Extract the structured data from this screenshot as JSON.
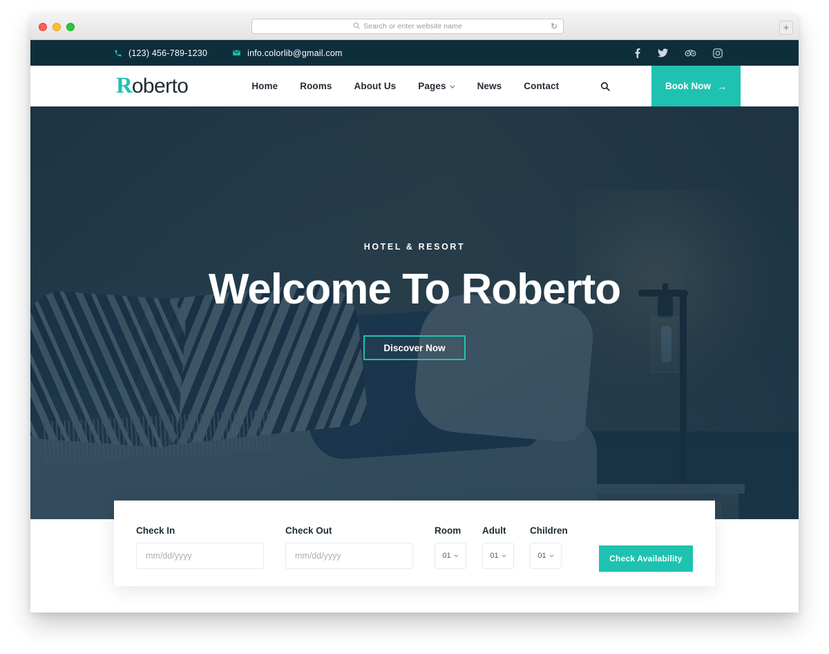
{
  "browser": {
    "address_placeholder": "Search or enter website name",
    "search_icon": "search-icon",
    "reload_icon": "reload-icon",
    "new_tab_label": "+"
  },
  "topbar": {
    "phone": "(123) 456-789-1230",
    "email": "info.colorlib@gmail.com",
    "phone_icon": "phone-icon",
    "email_icon": "envelope-icon",
    "social": [
      {
        "name": "facebook-icon",
        "label": "f"
      },
      {
        "name": "twitter-icon",
        "label": "t"
      },
      {
        "name": "tripadvisor-icon",
        "label": "ta"
      },
      {
        "name": "instagram-icon",
        "label": "ig"
      }
    ],
    "background": "#0f2e3c",
    "accent": "#1fc2b0"
  },
  "nav": {
    "logo_first": "R",
    "logo_rest": "oberto",
    "items": [
      {
        "label": "Home",
        "has_dropdown": false
      },
      {
        "label": "Rooms",
        "has_dropdown": false
      },
      {
        "label": "About Us",
        "has_dropdown": false
      },
      {
        "label": "Pages",
        "has_dropdown": true
      },
      {
        "label": "News",
        "has_dropdown": false
      },
      {
        "label": "Contact",
        "has_dropdown": false
      }
    ],
    "search_icon": "search-icon",
    "book_now": "Book Now",
    "book_now_arrow": "→"
  },
  "hero": {
    "subtitle": "HOTEL & RESORT",
    "title": "Welcome To Roberto",
    "cta": "Discover Now"
  },
  "booking": {
    "checkin_label": "Check In",
    "checkin_placeholder": "mm/dd/yyyy",
    "checkout_label": "Check Out",
    "checkout_placeholder": "mm/dd/yyyy",
    "room_label": "Room",
    "room_value": "01",
    "adult_label": "Adult",
    "adult_value": "01",
    "children_label": "Children",
    "children_value": "01",
    "submit": "Check Availability"
  },
  "colors": {
    "accent": "#1fc2b0",
    "dark": "#0f2e3c",
    "text": "#1d2b32"
  }
}
